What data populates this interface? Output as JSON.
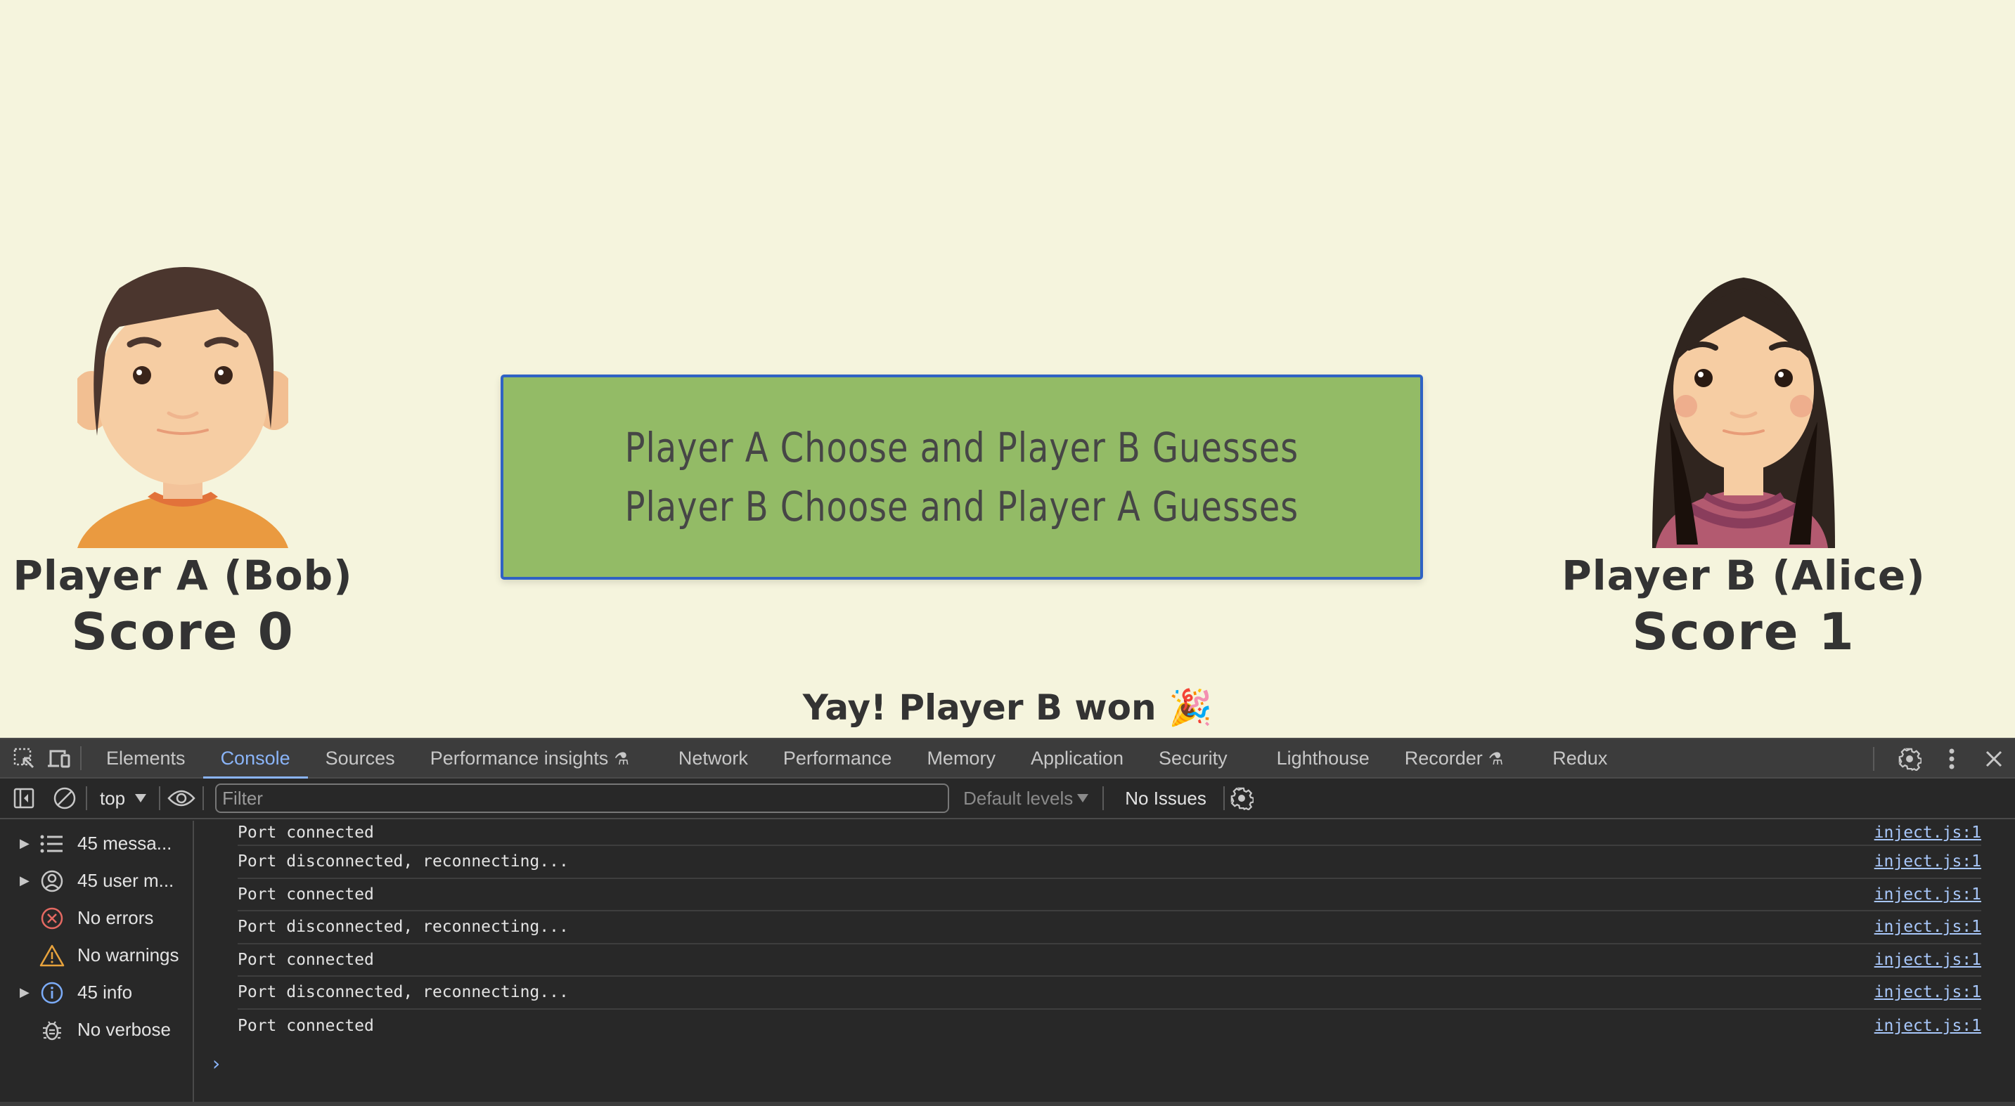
{
  "game": {
    "player_a": {
      "name": "Player A (Bob)",
      "score_label": "Score 0",
      "score": 0,
      "avatar": "boy-avatar"
    },
    "player_b": {
      "name": "Player B (Alice)",
      "score_label": "Score 1",
      "score": 1,
      "avatar": "girl-avatar"
    },
    "mode_options": [
      "Player A Choose and Player B Guesses",
      "Player B Choose and Player A Guesses"
    ],
    "result_text": "Yay! Player B won",
    "result_emoji": "🎉",
    "colors": {
      "background": "#f5f4dd",
      "mode_box": "#93bb66",
      "mode_border": "#2f62c4",
      "text": "#333333"
    }
  },
  "devtools": {
    "tabs": [
      "Elements",
      "Console",
      "Sources",
      "Performance insights",
      "Network",
      "Performance",
      "Memory",
      "Application",
      "Security",
      "Lighthouse",
      "Recorder",
      "Redux"
    ],
    "active_tab": "Console",
    "toolbar": {
      "context": "top",
      "filter_placeholder": "Filter",
      "filter_value": "",
      "levels": "Default levels",
      "issues": "No Issues"
    },
    "sidebar": [
      {
        "label": "45 messa...",
        "icon": "list-icon",
        "expandable": true
      },
      {
        "label": "45 user m...",
        "icon": "user-icon",
        "expandable": true
      },
      {
        "label": "No errors",
        "icon": "error-icon",
        "expandable": false
      },
      {
        "label": "No warnings",
        "icon": "warning-icon",
        "expandable": false
      },
      {
        "label": "45 info",
        "icon": "info-icon",
        "expandable": true
      },
      {
        "label": "No verbose",
        "icon": "bug-icon",
        "expandable": false
      }
    ],
    "messages": [
      {
        "text": "Port connected",
        "source": "inject.js:1"
      },
      {
        "text": "Port disconnected, reconnecting...",
        "source": "inject.js:1"
      },
      {
        "text": "Port connected",
        "source": "inject.js:1"
      },
      {
        "text": "Port disconnected, reconnecting...",
        "source": "inject.js:1"
      },
      {
        "text": "Port connected",
        "source": "inject.js:1"
      },
      {
        "text": "Port disconnected, reconnecting...",
        "source": "inject.js:1"
      },
      {
        "text": "Port connected",
        "source": "inject.js:1"
      }
    ],
    "prompt_symbol": "›"
  }
}
